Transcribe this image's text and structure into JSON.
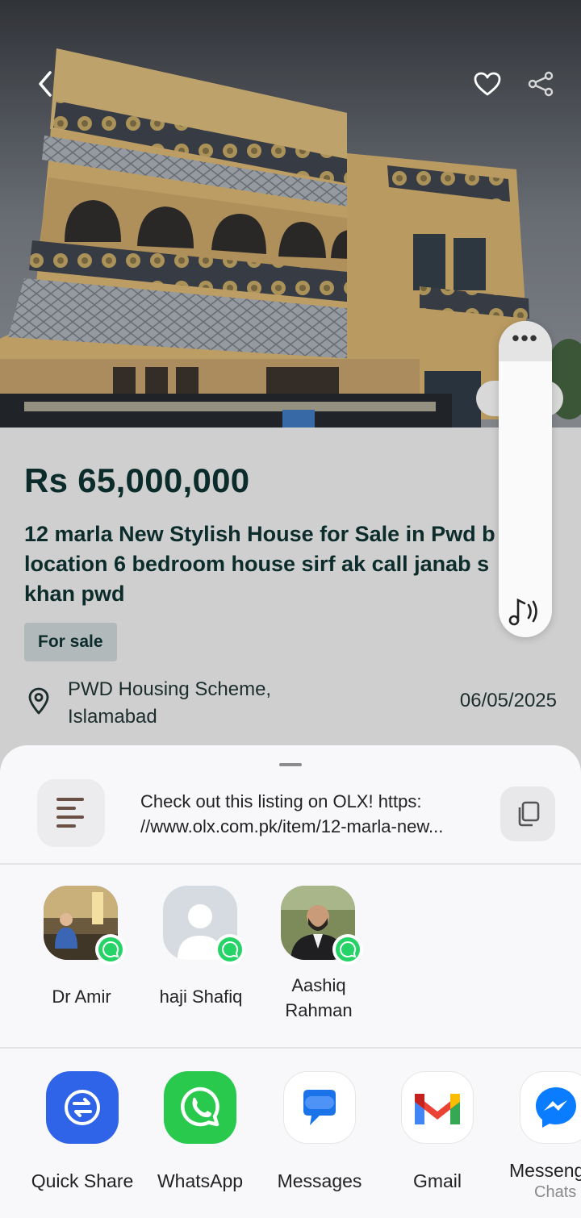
{
  "listing": {
    "price": "Rs 65,000,000",
    "title_lines": [
      "12 marla New Stylish House for Sale in Pwd b",
      "location 6 bedroom house sirf ak call janab s",
      "khan pwd"
    ],
    "badge": "For sale",
    "location_lines": [
      "PWD Housing Scheme,",
      "Islamabad"
    ],
    "date": "06/05/2025"
  },
  "hero": {
    "icons": {
      "back": "chevron-left-icon",
      "favorite": "heart-icon",
      "share": "share-icon"
    }
  },
  "floating_panel": {
    "dots": "•••",
    "icon": "music-sound-icon"
  },
  "share_sheet": {
    "text_lines": [
      "Check out this listing on OLX! https:",
      "//www.olx.com.pk/item/12-marla-new..."
    ],
    "contacts": [
      {
        "name_lines": [
          "Dr Amir"
        ],
        "app_badge": "whatsapp-icon"
      },
      {
        "name_lines": [
          "haji Shafiq"
        ],
        "app_badge": "whatsapp-icon"
      },
      {
        "name_lines": [
          "Aashiq",
          "Rahman"
        ],
        "app_badge": "whatsapp-icon"
      }
    ],
    "apps": [
      {
        "label": "Quick Share",
        "sub": "",
        "color": "#2f63e8"
      },
      {
        "label": "WhatsApp",
        "sub": "",
        "color": "#29c94d"
      },
      {
        "label": "Messages",
        "sub": "",
        "color": "#1a73e8"
      },
      {
        "label": "Gmail",
        "sub": "",
        "color": "#ea4335"
      },
      {
        "label": "Messenger",
        "sub": "Chats",
        "color": "#0a7cff"
      }
    ]
  }
}
